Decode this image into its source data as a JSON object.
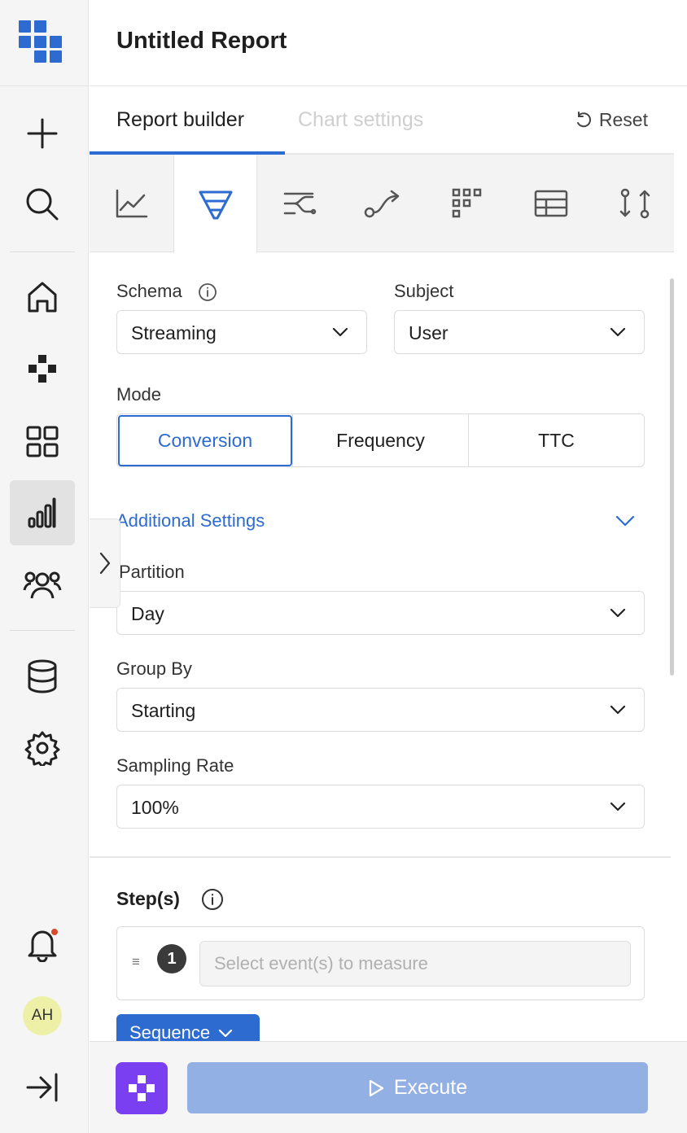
{
  "header": {
    "title": "Untitled Report"
  },
  "tabs": {
    "builder": "Report builder",
    "chart_settings": "Chart settings",
    "reset": "Reset"
  },
  "report_types": [
    "line-chart-icon",
    "funnel-icon",
    "flows-icon",
    "journey-icon",
    "retention-icon",
    "table-icon",
    "compare-icon"
  ],
  "schema": {
    "label": "Schema",
    "value": "Streaming"
  },
  "subject": {
    "label": "Subject",
    "value": "User"
  },
  "mode": {
    "label": "Mode",
    "options": [
      "Conversion",
      "Frequency",
      "TTC"
    ],
    "selected": "Conversion"
  },
  "additional_settings": {
    "label": "Additional Settings"
  },
  "partition": {
    "label": "Partition",
    "value": "Day"
  },
  "group_by": {
    "label": "Group By",
    "value": "Starting"
  },
  "sampling_rate": {
    "label": "Sampling Rate",
    "value": "100%"
  },
  "steps": {
    "title": "Step(s)",
    "number": "1",
    "placeholder": "Select event(s) to measure",
    "sequence_label": "Sequence"
  },
  "footer": {
    "execute_label": "Execute"
  },
  "user": {
    "initials": "AH"
  },
  "colors": {
    "accent": "#2d6bd1",
    "execute_disabled": "#93b0e4",
    "ai_button": "#7a3ff0",
    "notification_dot": "#d64b2b"
  }
}
